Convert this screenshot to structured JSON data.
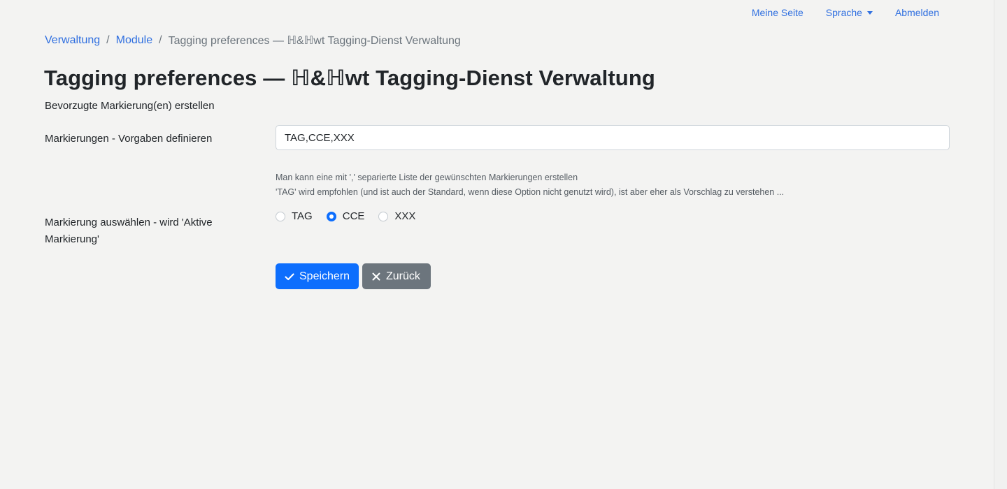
{
  "nav": {
    "my_page": "Meine Seite",
    "language": "Sprache",
    "logout": "Abmelden"
  },
  "breadcrumb": {
    "items": [
      "Verwaltung",
      "Module"
    ],
    "separator": "/",
    "current": "Tagging preferences — ℍ&ℍwt Tagging-Dienst Verwaltung"
  },
  "page": {
    "title": "Tagging preferences — ℍ&ℍwt Tagging-Dienst Verwaltung",
    "subtitle": "Bevorzugte Markierung(en) erstellen"
  },
  "form": {
    "tags_label": "Markierungen - Vorgaben definieren",
    "tags_value": "TAG,CCE,XXX",
    "help_line1": "Man kann eine mit ',' separierte Liste der gewünschten Markierungen erstellen",
    "help_line2": "'TAG' wird empfohlen (und ist auch der Standard, wenn diese Option nicht genutzt wird), ist aber eher als Vorschlag zu verstehen ...",
    "active_label": "Markierung auswählen - wird 'Aktive Markierung'",
    "options": [
      "TAG",
      "CCE",
      "XXX"
    ],
    "selected": "CCE"
  },
  "buttons": {
    "save": "Speichern",
    "back": "Zurück"
  },
  "icons": {
    "save": "check-icon",
    "back": "x-icon"
  },
  "colors": {
    "link": "#2f6fe0",
    "primary": "#0d6efd",
    "secondary": "#6c757d",
    "background": "#f3f3f2"
  }
}
